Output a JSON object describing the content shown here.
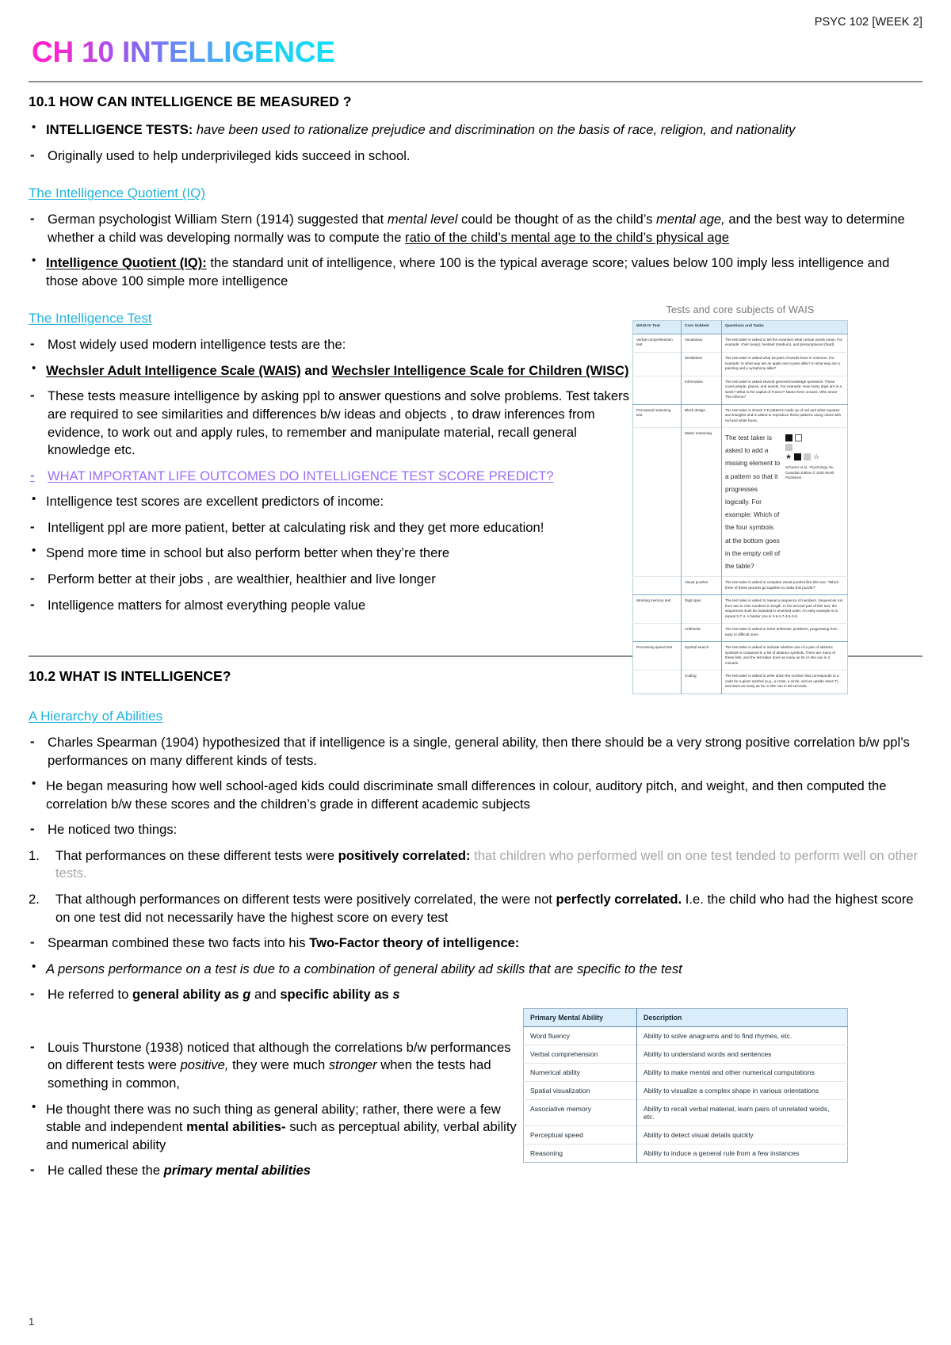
{
  "header": {
    "course": "PSYC 102 [WEEK 2]",
    "title": "CH 10 INTELLIGENCE",
    "page_number": "1"
  },
  "colors": {
    "title_gradient_start": "#ff22cc",
    "title_gradient_end": "#16dcf7",
    "subheading": "#21b3dd",
    "violet_heading": "#9b6ef3",
    "grey_text": "#a6a6a6",
    "table_header_blue": "#d9edfa"
  },
  "sections": {
    "s1": {
      "heading": "10.1 HOW CAN INTELLIGENCE BE MEASURED ?",
      "b1_label": "INTELLIGENCE TESTS:",
      "b1_text": " have been used to rationalize prejudice and discrimination on the basis of race, religion, and nationality",
      "b1_sub": "Originally used to help underprivileged kids succeed in school.",
      "sub1": "The Intelligence Quotient (IQ)",
      "p1_a": "German psychologist William Stern (1914) suggested that ",
      "p1_b": "mental level",
      "p1_c": " could be thought of as the child’s ",
      "p1_d": "mental age,",
      "p1_e": " and the best way to determine whether a child was developing normally was to compute the ",
      "p1_f": "ratio of the child’s mental age to the child’s physical age",
      "p2_label": "Intelligence Quotient (IQ):",
      "p2_text": " the standard unit of intelligence, where 100 is the typical average score; values below 100 imply less intelligence and those above 100 simple more intelligence",
      "sub2": "The Intelligence Test",
      "p3": "Most widely used modern intelligence tests are the:",
      "p4_a": "Wechsler Adult Intelligence Scale (WAIS)",
      "p4_b": " and ",
      "p4_c": "Wechsler Intelligence Scale for Children (WISC)",
      "p5": "These tests measure intelligence by asking ppl to answer questions and solve problems. Test takers are required to see similarities and differences b/w ideas and objects , to draw inferences from evidence, to work out and apply rules, to remember and manipulate material, recall general knowledge etc.",
      "p6_violet": "WHAT IMPORTANT LIFE OUTCOMES DO INTELLIGENCE TEST SCORE PREDICT?",
      "p7": "Intelligence test scores are excellent predictors of income:",
      "p8": "Intelligent ppl are more patient, better at calculating risk and they get more education!",
      "p9": "Spend more time in school but also perform better when they’re there",
      "p10": "Perform better at their jobs , are wealthier, healthier and live longer",
      "p11": "Intelligence matters for almost everything people value"
    },
    "s2": {
      "heading": "10.2 WHAT IS INTELLIGENCE?",
      "sub1": "A Hierarchy of Abilities",
      "p1": "Charles Spearman (1904) hypothesized that if intelligence is a single, general ability, then there should be a very strong positive correlation b/w ppl’s performances on many different kinds of tests.",
      "p2": "He began measuring how well school-aged kids could discriminate small differences in colour, auditory pitch, and weight, and then computed the correlation b/w these scores and the children’s grade in different  academic subjects",
      "p3": "He noticed two things:",
      "n1_num": "1.",
      "n1_a": "That performances on these different tests were ",
      "n1_b": "positively correlated:",
      "n1_c": " that children who performed well on one test tended to perform well on other tests.",
      "n2_num": "2.",
      "n2_a": "That although performances on different tests were positively correlated, the were not ",
      "n2_b": "perfectly correlated.",
      "n2_c": " I.e. the child who had the highest score on one test did not necessarily have the highest score on every test",
      "p4_a": "Spearman combined these two facts into his ",
      "p4_b": "Two-Factor theory of intelligence:",
      "p5": "A persons performance on a test is due to a combination of general ability ad skills that are specific to the test",
      "p6_a": "He referred to ",
      "p6_b": "general ability as ",
      "p6_c": "g",
      "p6_d": " and ",
      "p6_e": "specific ability as ",
      "p6_f": "s",
      "p7_a": "Louis Thurstone (1938) noticed that although the correlations b/w performances on different tests were ",
      "p7_b": "positive,",
      "p7_c": " they were much ",
      "p7_d": "stronger",
      "p7_e": " when the tests had something in common,",
      "p8_a": "He thought there was no such thing as general ability; rather, there were a few stable and independent ",
      "p8_b": "mental abilities-",
      "p8_c": " such as perceptual ability, verbal ability and numerical ability",
      "p9_a": "He called these the ",
      "p9_b": "primary mental abilities"
    }
  },
  "wais_figure": {
    "caption": "Tests and core subjects of WAIS",
    "headers": [
      "WAIS-IV Test",
      "Core Subtest",
      "Questions and Tasks"
    ],
    "rows": [
      {
        "test": "Verbal comprehension test",
        "subtest": "Vocabulary",
        "task": "The test taker is asked to tell the examiner what certain words mean. For example: choir (easy), hesitant (medium), and presumptuous (hard)."
      },
      {
        "test": "",
        "subtest": "Similarities",
        "task": "The test taker is asked what 19 pairs of words have in common. For example: In what way are an apple and a pear alike? In what way are a painting and a symphony alike?"
      },
      {
        "test": "",
        "subtest": "Information",
        "task": "The test taker is asked several general knowledge questions. These cover people, places, and events. For example: How many days are in a week? What is the capital of France? Name three oceans. Who wrote The Inferno?"
      },
      {
        "test": "Perceptual reasoning test",
        "subtest": "Block design",
        "task": "The test taker is shown 2-D patterns made up of red and white squares and triangles and is asked to reproduce these patterns using cubes with red and white faces."
      },
      {
        "test": "",
        "subtest": "Matrix reasoning",
        "task": "The test taker is asked to add a missing element to a pattern so that it progresses logically. For example: Which of the four symbols at the bottom goes in the empty cell of the table?",
        "credit": "Schacter et al., Psychology, 5e, Canadian Edition © 2020 Worth Publishers"
      },
      {
        "test": "",
        "subtest": "Visual puzzles",
        "task": "The test taker is asked to complete visual puzzles like this one: “Which three of these pictures go together to make this puzzle?”"
      },
      {
        "test": "Working memory test",
        "subtest": "Digit span",
        "task": "The test taker is asked to repeat a sequence of numbers. Sequences run from two to nine numbers in length. In the second part of this test, the sequences must be repeated in reversed order. An easy example is to repeat 3-7-4. A harder one is 3-9-1-7-4-5-3-9."
      },
      {
        "test": "",
        "subtest": "Arithmetic",
        "task": "The test taker is asked to solve arithmetic problems, progressing from easy to difficult ones."
      },
      {
        "test": "Processing speed test",
        "subtest": "Symbol search",
        "task": "The test taker is asked to indicate whether one of a pair of abstract symbols is contained in a list of abstract symbols. There are many of these lists, and the test taker does as many as he or she can in 2 minutes."
      },
      {
        "test": "",
        "subtest": "Coding",
        "task": "The test taker is asked to write down the number that corresponds to a code for a given symbol (e.g., a cross, a circle, and an upside down T) and does as many as he or she can in 90 seconds."
      }
    ]
  },
  "pma_table": {
    "headers": [
      "Primary Mental Ability",
      "Description"
    ],
    "rows": [
      [
        "Word fluency",
        "Ability to solve anagrams and to find rhymes, etc."
      ],
      [
        "Verbal comprehension",
        "Ability to understand words and sentences"
      ],
      [
        "Numerical ability",
        "Ability to make mental and other numerical computations"
      ],
      [
        "Spatial visualization",
        "Ability to visualize a complex shape in various orientations"
      ],
      [
        "Associative memory",
        "Ability to recall verbal material, learn pairs of unrelated words, etc."
      ],
      [
        "Perceptual speed",
        "Ability to detect visual details quickly"
      ],
      [
        "Reasoning",
        "Ability to induce a general rule from a few instances"
      ]
    ]
  }
}
